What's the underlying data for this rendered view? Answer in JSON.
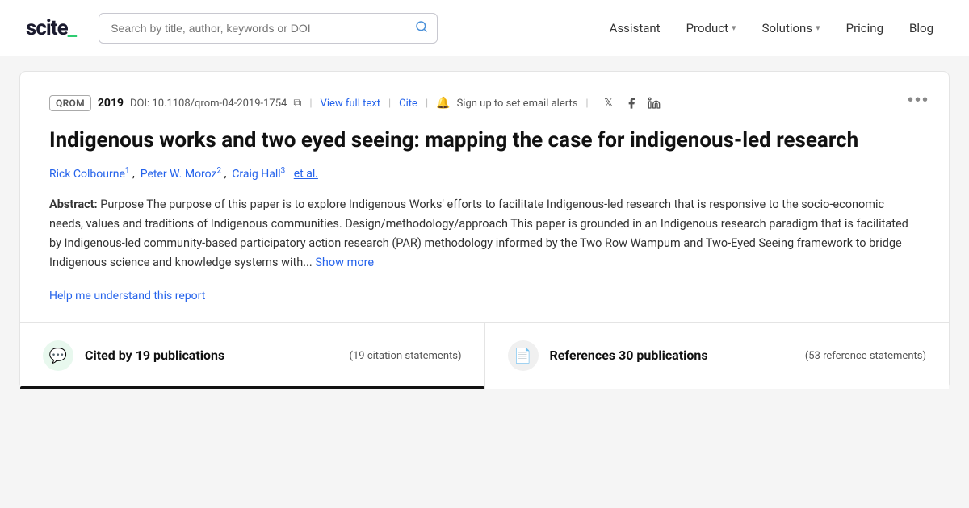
{
  "logo": {
    "text": "scite_"
  },
  "navbar": {
    "search_placeholder": "Search by title, author, keywords or DOI",
    "links": [
      {
        "label": "Assistant",
        "has_chevron": false
      },
      {
        "label": "Product",
        "has_chevron": true
      },
      {
        "label": "Solutions",
        "has_chevron": true
      },
      {
        "label": "Pricing",
        "has_chevron": false
      },
      {
        "label": "Blog",
        "has_chevron": false
      }
    ]
  },
  "paper": {
    "journal": "QROM",
    "year": "2019",
    "doi": "DOI: 10.1108/qrom-04-2019-1754",
    "view_full_text": "View full text",
    "cite": "Cite",
    "alert_text": "Sign up to set email alerts",
    "title": "Indigenous works and two eyed seeing: mapping the case for indigenous-led research",
    "authors": [
      {
        "name": "Rick Colbourne",
        "sup": "1"
      },
      {
        "name": "Peter W. Moroz",
        "sup": "2"
      },
      {
        "name": "Craig Hall",
        "sup": "3"
      }
    ],
    "et_al": "et al.",
    "abstract_label": "Abstract:",
    "abstract_text": "Purpose The purpose of this paper is to explore Indigenous Works' efforts to facilitate Indigenous-led research that is responsive to the socio-economic needs, values and traditions of Indigenous communities. Design/methodology/approach This paper is grounded in an Indigenous research paradigm that is facilitated by Indigenous-led community-based participatory action research (PAR) methodology informed by the Two Row Wampum and Two-Eyed Seeing framework to bridge Indigenous science and knowledge systems with...",
    "show_more": "Show more",
    "help_link": "Help me understand this report"
  },
  "tabs": [
    {
      "id": "cited-by",
      "icon": "💬",
      "icon_style": "green",
      "main_label": "Cited by 19 publications",
      "count_label": "(19 citation statements)",
      "active": true
    },
    {
      "id": "references",
      "icon": "📄",
      "icon_style": "gray",
      "main_label": "References 30 publications",
      "count_label": "(53 reference statements)",
      "active": false
    }
  ],
  "more_button_label": "•••"
}
